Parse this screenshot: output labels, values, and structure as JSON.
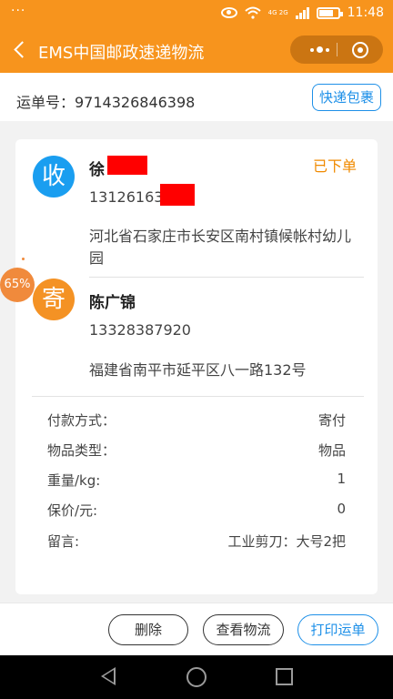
{
  "status_bar": {
    "dots": "···",
    "network": "4G 2G",
    "time": "11:48"
  },
  "header": {
    "title": "EMS中国邮政速递物流"
  },
  "tracking": {
    "label": "运单号：9714326846398",
    "package_button": "快递包裹"
  },
  "order": {
    "status": "已下单"
  },
  "receiver": {
    "badge": "收",
    "name": "徐",
    "phone": "13126163",
    "address": "河北省石家庄市长安区南村镇候帐村幼儿园"
  },
  "sender": {
    "badge": "寄",
    "name": "陈广锦",
    "phone": "13328387920",
    "address": "福建省南平市延平区八一路132号"
  },
  "details": [
    {
      "key": "付款方式：",
      "value": "寄付"
    },
    {
      "key": "物品类型：",
      "value": "物品"
    },
    {
      "key": "重量/kg:",
      "value": "1"
    },
    {
      "key": "保价/元:",
      "value": "0"
    },
    {
      "key": "留言:",
      "value": "工业剪刀：大号2把"
    }
  ],
  "floating_badge": "65%",
  "actions": {
    "delete": "删除",
    "view_logistics": "查看物流",
    "print": "打印运单"
  },
  "colors": {
    "brand": "#f7941d",
    "accent_blue": "#1e90e8",
    "status_orange": "#f08a00"
  }
}
